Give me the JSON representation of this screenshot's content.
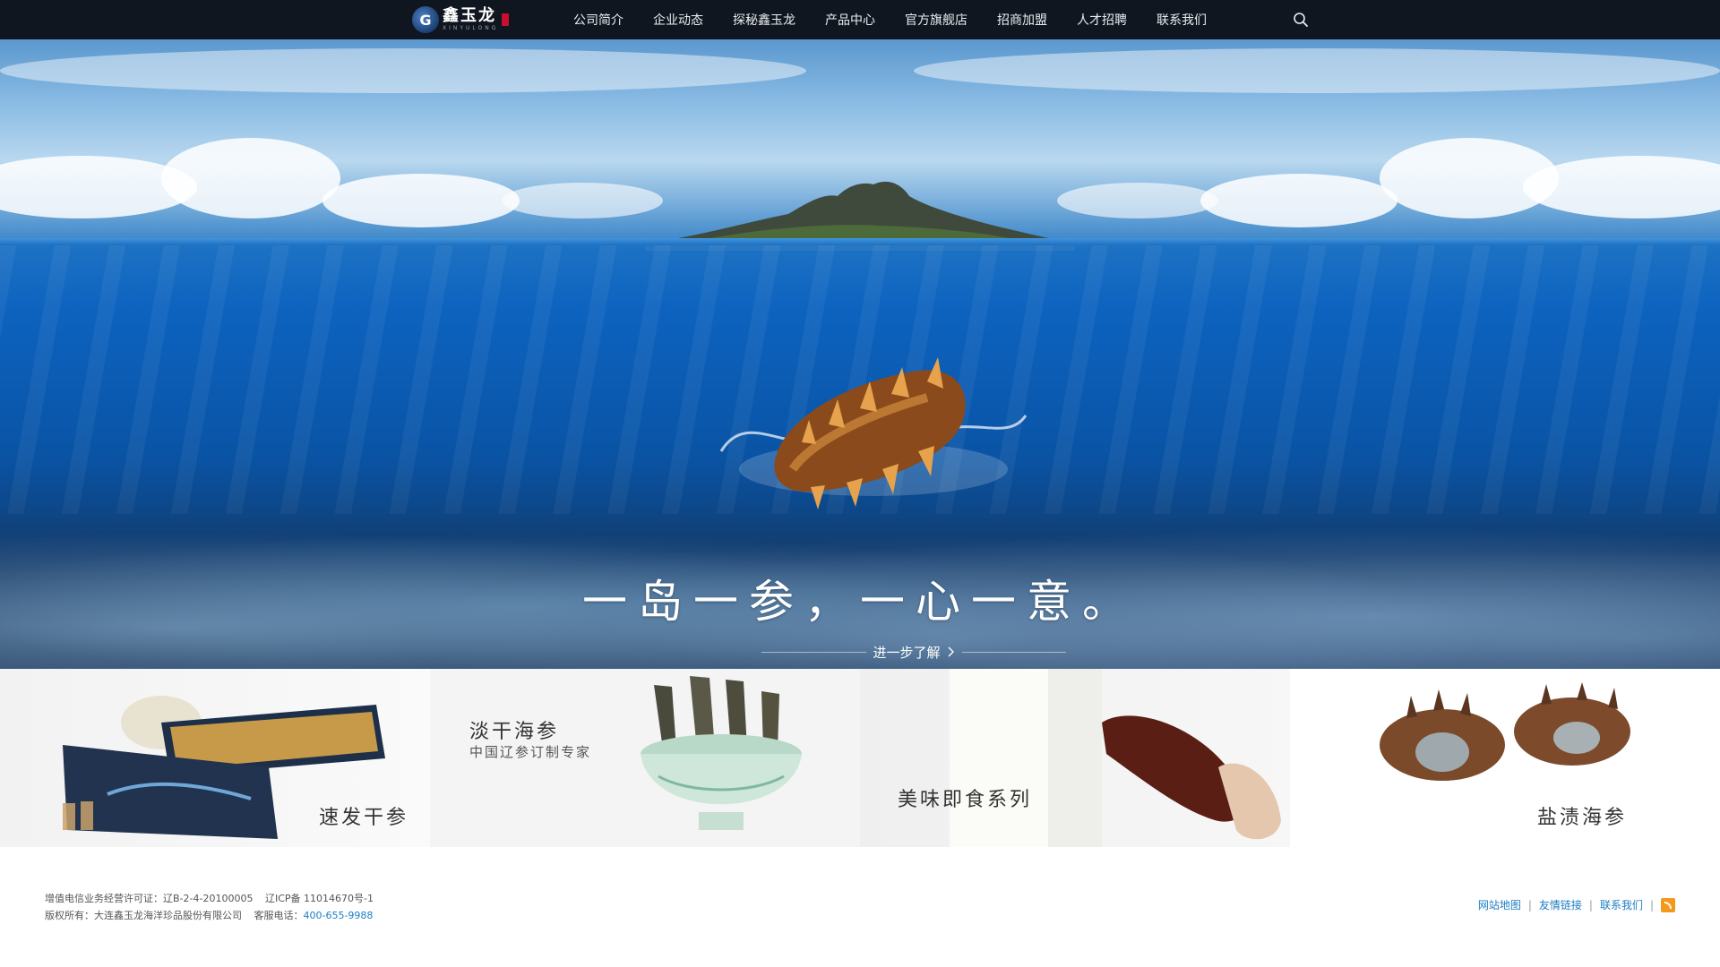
{
  "header": {
    "logo": {
      "cn": "鑫玉龙",
      "en": "XINYULONG",
      "mark": "G"
    },
    "nav": [
      {
        "label": "公司简介"
      },
      {
        "label": "企业动态"
      },
      {
        "label": "探秘鑫玉龙"
      },
      {
        "label": "产品中心"
      },
      {
        "label": "官方旗舰店"
      },
      {
        "label": "招商加盟"
      },
      {
        "label": "人才招聘"
      },
      {
        "label": "联系我们"
      }
    ],
    "search_icon": "search-icon"
  },
  "hero": {
    "slogan": "一岛一参，一心一意。",
    "learn_more": "进一步了解",
    "learn_more_icon": "chevron-right-icon"
  },
  "products": [
    {
      "label": "速发干参",
      "sub": ""
    },
    {
      "label": "淡干海参",
      "sub": "中国辽参订制专家"
    },
    {
      "label": "美味即食系列",
      "sub": ""
    },
    {
      "label": "盐渍海参",
      "sub": ""
    }
  ],
  "footer": {
    "license": "增值电信业务经营许可证：辽B-2-4-20100005",
    "icp": "辽ICP备 11014670号-1",
    "copyright": "版权所有：大连鑫玉龙海洋珍品股份有限公司",
    "service_label": "客服电话：",
    "service_phone": "400-655-9988",
    "links": [
      {
        "label": "网站地图"
      },
      {
        "label": "友情链接"
      },
      {
        "label": "联系我们"
      }
    ],
    "rss_icon": "rss-icon"
  },
  "colors": {
    "nav_bg": "#10161f",
    "link": "#1d7dc3",
    "ocean": "#0d63bf"
  }
}
